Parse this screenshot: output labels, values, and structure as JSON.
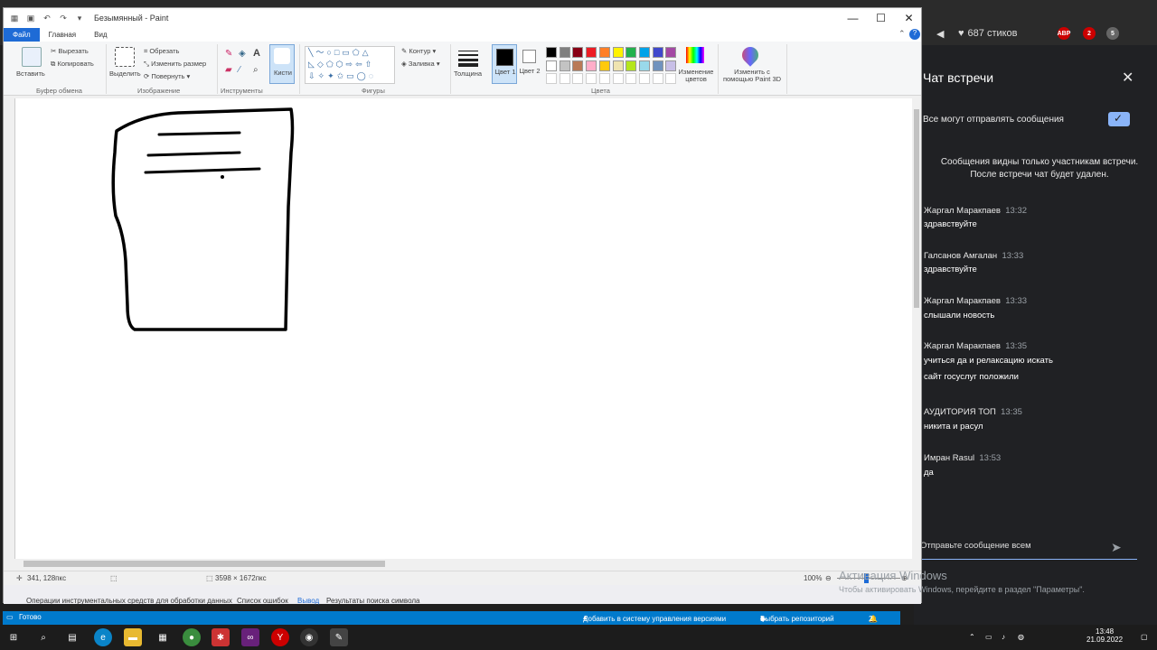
{
  "browser": {
    "count_label": "687 стиков",
    "ext_badges": [
      "ABP",
      "2",
      "5"
    ]
  },
  "paint": {
    "title": "Безымянный - Paint",
    "menu": {
      "file": "Файл",
      "home": "Главная",
      "view": "Вид"
    },
    "ribbon": {
      "clipboard": {
        "paste": "Вставить",
        "cut": "Вырезать",
        "copy": "Копировать",
        "label": "Буфер обмена"
      },
      "image": {
        "select": "Выделить",
        "crop": "Обрезать",
        "resize": "Изменить размер",
        "rotate": "Повернуть",
        "label": "Изображение"
      },
      "tools": {
        "label": "Инструменты"
      },
      "brushes": {
        "label": "Кисти"
      },
      "shapes": {
        "outline": "Контур",
        "fill": "Заливка",
        "label": "Фигуры"
      },
      "thickness": "Толщина",
      "color1": "Цвет 1",
      "color2": "Цвет 2",
      "edit_colors": "Изменение цветов",
      "paint3d": "Изменить с помощью Paint 3D",
      "colors_label": "Цвета",
      "palette": [
        "#000000",
        "#7f7f7f",
        "#880015",
        "#ed1c24",
        "#ff7f27",
        "#fff200",
        "#22b14c",
        "#00a2e8",
        "#3f48cc",
        "#a349a4",
        "#ffffff",
        "#c3c3c3",
        "#b97a57",
        "#ffaec9",
        "#ffc90e",
        "#efe4b0",
        "#b5e61d",
        "#99d9ea",
        "#7092be",
        "#c8bfe7"
      ]
    },
    "status": {
      "cursor": "341, 128пкс",
      "size": "3598 × 1672пкс",
      "zoom": "100%"
    }
  },
  "vs": {
    "tabs": [
      "Операции инструментальных средств для обработки данных",
      "Список ошибок",
      "Вывод",
      "Результаты поиска символа"
    ],
    "status_ready": "Готово",
    "add_to_vcs": "Добавить в систему управления версиями",
    "choose_repo": "Выбрать репозиторий",
    "errors": "2"
  },
  "activation": {
    "title": "Активация Windows",
    "subtitle": "Чтобы активировать Windows, перейдите в раздел \"Параметры\"."
  },
  "chat": {
    "title": "Чат встречи",
    "allow_label": "Все могут отправлять сообщения",
    "notice_line1": "Сообщения видны только участникам встречи.",
    "notice_line2": "После встречи чат будет удален.",
    "messages": [
      {
        "author": "Жаргал Маракпаев",
        "time": "13:32",
        "text": "здравствуйте"
      },
      {
        "author": "Галсанов Амгалан",
        "time": "13:33",
        "text": "здравствуйте"
      },
      {
        "author": "Жаргал Маракпаев",
        "time": "13:33",
        "text": "слышали новость"
      },
      {
        "author": "Жаргал Маракпаев",
        "time": "13:35",
        "text": "учиться да и релаксацию искать"
      },
      {
        "author": "",
        "time": "",
        "text": "сайт госуслуг положили"
      },
      {
        "author": "АУДИТОРИЯ ТОП",
        "time": "13:35",
        "text": "никита и расул"
      },
      {
        "author": "Имран Rasul",
        "time": "13:53",
        "text": "да"
      }
    ],
    "input_placeholder": "Отправьте сообщение всем"
  },
  "taskbar": {
    "time": "13:48",
    "date": "21.09.2022"
  }
}
